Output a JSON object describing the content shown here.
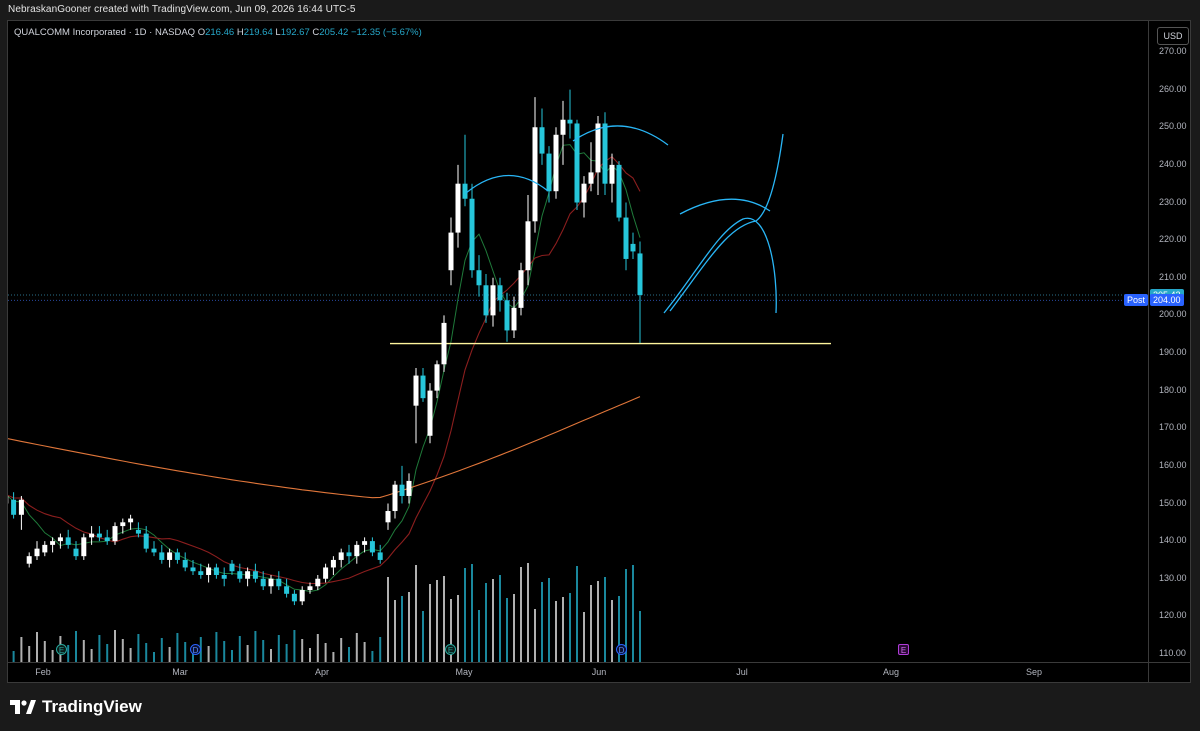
{
  "caption": "NebraskanGooner created with TradingView.com, Jun 09, 2026 16:44 UTC-5",
  "legend": {
    "symbol": "QUALCOMM Incorporated · 1D · NASDAQ",
    "o_label": "O",
    "o_value": "216.46",
    "h_label": "H",
    "h_value": "219.64",
    "l_label": "L",
    "l_value": "192.67",
    "c_label": "C",
    "c_value": "205.42",
    "change": "−12.35 (−5.67%)"
  },
  "currency_button": "USD",
  "price_ticks": [
    "270.00",
    "260.00",
    "250.00",
    "240.00",
    "230.00",
    "220.00",
    "210.00",
    "200.00",
    "190.00",
    "180.00",
    "170.00",
    "160.00",
    "150.00",
    "140.00",
    "130.00",
    "120.00",
    "110.00"
  ],
  "time_ticks": [
    "Feb",
    "Mar",
    "Apr",
    "May",
    "Jun",
    "Jul",
    "Aug",
    "Sep"
  ],
  "last_price_tag": "205.42",
  "post_label": "Post",
  "post_price_tag": "204.00",
  "events": {
    "earnings": "E",
    "dividend": "D"
  },
  "brand": "TradingView",
  "colors": {
    "up": "#ffffff",
    "down": "#26c6da",
    "ma_green": "#1f7a3a",
    "ma_red": "#8b1e1e",
    "ma_orange": "#e0763a",
    "support_line": "#fff59d",
    "drawing": "#29b6f6",
    "last_price": "#26a7c9",
    "post": "#2962ff"
  },
  "chart_data": {
    "type": "candlestick",
    "symbol": "QCOM",
    "interval": "1D",
    "ylim": [
      110,
      270
    ],
    "support_level": 192.5,
    "last_price": 205.42,
    "post_market": 204.0,
    "candles": [
      {
        "o": 155,
        "h": 157,
        "l": 153,
        "c": 156
      },
      {
        "o": 154,
        "h": 156,
        "l": 151,
        "c": 152
      },
      {
        "o": 152,
        "h": 154,
        "l": 150,
        "c": 153
      },
      {
        "o": 153,
        "h": 155,
        "l": 148,
        "c": 149
      },
      {
        "o": 150,
        "h": 153,
        "l": 148,
        "c": 152
      },
      {
        "o": 151,
        "h": 153,
        "l": 146,
        "c": 147
      },
      {
        "o": 147,
        "h": 152,
        "l": 143,
        "c": 151
      },
      {
        "o": 134,
        "h": 137,
        "l": 133,
        "c": 136
      },
      {
        "o": 136,
        "h": 140,
        "l": 135,
        "c": 138
      },
      {
        "o": 137,
        "h": 140,
        "l": 136,
        "c": 139
      },
      {
        "o": 139,
        "h": 141,
        "l": 137,
        "c": 140
      },
      {
        "o": 140,
        "h": 142,
        "l": 138,
        "c": 141
      },
      {
        "o": 141,
        "h": 143,
        "l": 138,
        "c": 139
      },
      {
        "o": 138,
        "h": 140,
        "l": 135,
        "c": 136
      },
      {
        "o": 136,
        "h": 142,
        "l": 135,
        "c": 141
      },
      {
        "o": 141,
        "h": 144,
        "l": 139,
        "c": 142
      },
      {
        "o": 142,
        "h": 144,
        "l": 140,
        "c": 141
      },
      {
        "o": 141,
        "h": 143,
        "l": 139,
        "c": 140
      },
      {
        "o": 140,
        "h": 145,
        "l": 139,
        "c": 144
      },
      {
        "o": 144,
        "h": 146,
        "l": 142,
        "c": 145
      },
      {
        "o": 145,
        "h": 147,
        "l": 143,
        "c": 146
      },
      {
        "o": 143,
        "h": 145,
        "l": 141,
        "c": 142
      },
      {
        "o": 142,
        "h": 144,
        "l": 137,
        "c": 138
      },
      {
        "o": 138,
        "h": 140,
        "l": 136,
        "c": 137
      },
      {
        "o": 137,
        "h": 139,
        "l": 134,
        "c": 135
      },
      {
        "o": 135,
        "h": 138,
        "l": 133,
        "c": 137
      },
      {
        "o": 137,
        "h": 138,
        "l": 134,
        "c": 135
      },
      {
        "o": 135,
        "h": 137,
        "l": 132,
        "c": 133
      },
      {
        "o": 133,
        "h": 135,
        "l": 131,
        "c": 132
      },
      {
        "o": 132,
        "h": 134,
        "l": 130,
        "c": 131
      },
      {
        "o": 131,
        "h": 134,
        "l": 129,
        "c": 133
      },
      {
        "o": 133,
        "h": 134,
        "l": 130,
        "c": 131
      },
      {
        "o": 131,
        "h": 133,
        "l": 128,
        "c": 130
      },
      {
        "o": 134,
        "h": 135,
        "l": 131,
        "c": 132
      },
      {
        "o": 132,
        "h": 134,
        "l": 129,
        "c": 130
      },
      {
        "o": 130,
        "h": 133,
        "l": 128,
        "c": 132
      },
      {
        "o": 132,
        "h": 134,
        "l": 129,
        "c": 130
      },
      {
        "o": 130,
        "h": 132,
        "l": 127,
        "c": 128
      },
      {
        "o": 128,
        "h": 131,
        "l": 126,
        "c": 130
      },
      {
        "o": 130,
        "h": 132,
        "l": 127,
        "c": 128
      },
      {
        "o": 128,
        "h": 130,
        "l": 125,
        "c": 126
      },
      {
        "o": 126,
        "h": 127,
        "l": 123,
        "c": 124
      },
      {
        "o": 124,
        "h": 128,
        "l": 123,
        "c": 127
      },
      {
        "o": 127,
        "h": 129,
        "l": 126,
        "c": 128
      },
      {
        "o": 128,
        "h": 131,
        "l": 127,
        "c": 130
      },
      {
        "o": 130,
        "h": 134,
        "l": 129,
        "c": 133
      },
      {
        "o": 133,
        "h": 136,
        "l": 131,
        "c": 135
      },
      {
        "o": 135,
        "h": 138,
        "l": 133,
        "c": 137
      },
      {
        "o": 137,
        "h": 139,
        "l": 134,
        "c": 136
      },
      {
        "o": 136,
        "h": 140,
        "l": 134,
        "c": 139
      },
      {
        "o": 139,
        "h": 141,
        "l": 137,
        "c": 140
      },
      {
        "o": 140,
        "h": 141,
        "l": 136,
        "c": 137
      },
      {
        "o": 137,
        "h": 139,
        "l": 134,
        "c": 135
      },
      {
        "o": 145,
        "h": 150,
        "l": 143,
        "c": 148
      },
      {
        "o": 148,
        "h": 156,
        "l": 146,
        "c": 155
      },
      {
        "o": 155,
        "h": 160,
        "l": 150,
        "c": 152
      },
      {
        "o": 152,
        "h": 158,
        "l": 150,
        "c": 156
      },
      {
        "o": 176,
        "h": 186,
        "l": 166,
        "c": 184
      },
      {
        "o": 184,
        "h": 186,
        "l": 177,
        "c": 178
      },
      {
        "o": 168,
        "h": 182,
        "l": 166,
        "c": 180
      },
      {
        "o": 180,
        "h": 188,
        "l": 178,
        "c": 187
      },
      {
        "o": 187,
        "h": 200,
        "l": 185,
        "c": 198
      },
      {
        "o": 212,
        "h": 226,
        "l": 208,
        "c": 222
      },
      {
        "o": 222,
        "h": 240,
        "l": 218,
        "c": 235
      },
      {
        "o": 235,
        "h": 248,
        "l": 229,
        "c": 231
      },
      {
        "o": 231,
        "h": 235,
        "l": 210,
        "c": 212
      },
      {
        "o": 212,
        "h": 216,
        "l": 205,
        "c": 208
      },
      {
        "o": 208,
        "h": 211,
        "l": 198,
        "c": 200
      },
      {
        "o": 200,
        "h": 210,
        "l": 197,
        "c": 208
      },
      {
        "o": 208,
        "h": 210,
        "l": 201,
        "c": 204
      },
      {
        "o": 204,
        "h": 206,
        "l": 193,
        "c": 196
      },
      {
        "o": 196,
        "h": 205,
        "l": 194,
        "c": 202
      },
      {
        "o": 202,
        "h": 214,
        "l": 200,
        "c": 212
      },
      {
        "o": 212,
        "h": 232,
        "l": 208,
        "c": 225
      },
      {
        "o": 225,
        "h": 258,
        "l": 222,
        "c": 250
      },
      {
        "o": 250,
        "h": 255,
        "l": 240,
        "c": 243
      },
      {
        "o": 243,
        "h": 245,
        "l": 230,
        "c": 233
      },
      {
        "o": 233,
        "h": 250,
        "l": 231,
        "c": 248
      },
      {
        "o": 248,
        "h": 257,
        "l": 240,
        "c": 252
      },
      {
        "o": 252,
        "h": 260,
        "l": 247,
        "c": 251
      },
      {
        "o": 251,
        "h": 252,
        "l": 228,
        "c": 230
      },
      {
        "o": 230,
        "h": 237,
        "l": 226,
        "c": 235
      },
      {
        "o": 235,
        "h": 246,
        "l": 233,
        "c": 238
      },
      {
        "o": 238,
        "h": 253,
        "l": 232,
        "c": 251
      },
      {
        "o": 251,
        "h": 254,
        "l": 232,
        "c": 235
      },
      {
        "o": 235,
        "h": 243,
        "l": 230,
        "c": 240
      },
      {
        "o": 240,
        "h": 241,
        "l": 225,
        "c": 226
      },
      {
        "o": 226,
        "h": 230,
        "l": 212,
        "c": 215
      },
      {
        "o": 219,
        "h": 222,
        "l": 215,
        "c": 217
      },
      {
        "o": 216.46,
        "h": 219.64,
        "l": 192.67,
        "c": 205.42
      }
    ]
  }
}
